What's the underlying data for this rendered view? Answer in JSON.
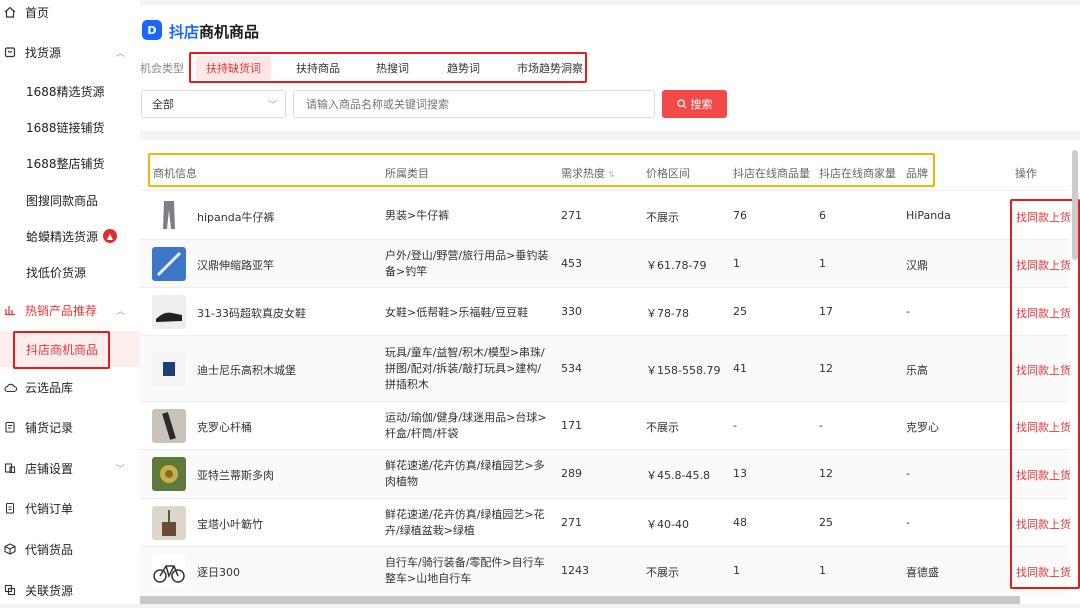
{
  "sidebar": {
    "items": [
      {
        "label": "首页",
        "icon": "home-icon"
      },
      {
        "label": "找货源",
        "icon": "source-icon"
      },
      {
        "label": "1688精选货源"
      },
      {
        "label": "1688链接铺货"
      },
      {
        "label": "1688整店铺货"
      },
      {
        "label": "图搜同款商品"
      },
      {
        "label": "蛤蟆精选货源"
      },
      {
        "label": "找低价货源"
      },
      {
        "label": "热销产品推荐",
        "icon": "chart-icon"
      },
      {
        "label": "抖店商机商品"
      },
      {
        "label": "云选品库",
        "icon": "cloud-icon"
      },
      {
        "label": "铺货记录",
        "icon": "record-icon"
      },
      {
        "label": "店铺设置",
        "icon": "store-icon"
      },
      {
        "label": "代销订单",
        "icon": "order-icon"
      },
      {
        "label": "代销货品",
        "icon": "box-icon"
      },
      {
        "label": "关联货源",
        "icon": "link-icon"
      }
    ]
  },
  "page": {
    "logo_text": "D",
    "title_blue": "抖店",
    "title_rest": "商机商品",
    "filter_label": "机会类型",
    "tabs": [
      "扶持缺货词",
      "扶持商品",
      "热搜词",
      "趋势词",
      "市场趋势洞察"
    ],
    "select_value": "全部",
    "search_placeholder": "请输入商品名称或关键词搜索",
    "search_button": "搜索"
  },
  "table": {
    "headers": [
      "商机信息",
      "所属类目",
      "需求热度",
      "价格区间",
      "抖店在线商品量",
      "抖店在线商家量",
      "品牌",
      "操作"
    ],
    "rows": [
      {
        "name": "hipanda牛仔裤",
        "category": "男装>牛仔裤",
        "heat": "271",
        "price": "不展示",
        "products": "76",
        "merchants": "6",
        "brand": "HiPanda",
        "action": "找同款上货"
      },
      {
        "name": "汉鼎伸缩路亚竿",
        "category": "户外/登山/野营/旅行用品>垂钓装备>钓竿",
        "heat": "453",
        "price": "￥61.78-79",
        "products": "1",
        "merchants": "1",
        "brand": "汉鼎",
        "action": "找同款上货"
      },
      {
        "name": "31-33码超软真皮女鞋",
        "category": "女鞋>低帮鞋>乐福鞋/豆豆鞋",
        "heat": "330",
        "price": "￥78-78",
        "products": "25",
        "merchants": "17",
        "brand": "-",
        "action": "找同款上货"
      },
      {
        "name": "迪士尼乐高积木城堡",
        "category": "玩具/童车/益智/积木/模型>串珠/拼图/配对/拆装/敲打玩具>建构/拼插积木",
        "heat": "534",
        "price": "￥158-558.79",
        "products": "41",
        "merchants": "12",
        "brand": "乐高",
        "action": "找同款上货"
      },
      {
        "name": "克罗心杆桶",
        "category": "运动/瑜伽/健身/球迷用品>台球>杆盒/杆筒/杆袋",
        "heat": "171",
        "price": "不展示",
        "products": "-",
        "merchants": "-",
        "brand": "克罗心",
        "action": "找同款上货"
      },
      {
        "name": "亚特兰蒂斯多肉",
        "category": "鲜花速递/花卉仿真/绿植园艺>多肉植物",
        "heat": "289",
        "price": "￥45.8-45.8",
        "products": "13",
        "merchants": "12",
        "brand": "-",
        "action": "找同款上货"
      },
      {
        "name": "宝塔小叶簕竹",
        "category": "鲜花速递/花卉仿真/绿植园艺>花卉/绿植盆栽>绿植",
        "heat": "271",
        "price": "￥40-40",
        "products": "48",
        "merchants": "25",
        "brand": "-",
        "action": "找同款上货"
      },
      {
        "name": "逐日300",
        "category": "自行车/骑行装备/零配件>自行车整车>山地自行车",
        "heat": "1243",
        "price": "不展示",
        "products": "1",
        "merchants": "1",
        "brand": "喜德盛",
        "action": "找同款上货"
      }
    ]
  },
  "colors": {
    "accent": "#e5383b",
    "brand_blue": "#1a66ff",
    "highlight_red": "#e31c1c",
    "highlight_yellow": "#f2b705"
  }
}
